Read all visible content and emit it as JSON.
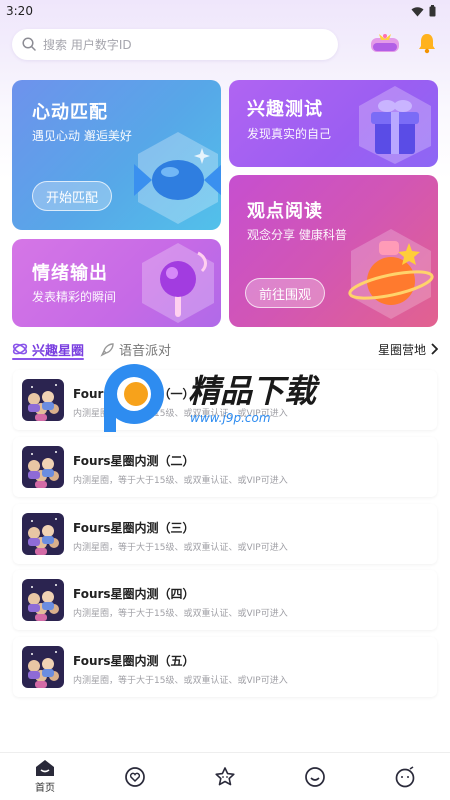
{
  "status_bar": {
    "time": "3:20"
  },
  "search": {
    "placeholder": "搜索 用户数字ID"
  },
  "header": {
    "badge_icon": "gift-badge-icon",
    "bell_icon": "bell-icon",
    "accent": "#8a55ea"
  },
  "cards": {
    "match": {
      "title": "心动匹配",
      "subtitle": "遇见心动 邂逅美好",
      "button": "开始匹配"
    },
    "interest": {
      "title": "兴趣测试",
      "subtitle": "发现真实的自己"
    },
    "emotion": {
      "title": "情绪输出",
      "subtitle": "发表精彩的瞬间"
    },
    "opinion": {
      "title": "观点阅读",
      "subtitle": "观念分享 健康科普",
      "button": "前往围观"
    }
  },
  "tabs": {
    "items": [
      {
        "label": "兴趣星圈",
        "active": true
      },
      {
        "label": "语音派对",
        "active": false
      }
    ],
    "link": "星圈营地"
  },
  "circles": [
    {
      "title": "Fours星圈内测（一）",
      "desc": "内测星圈，等于大于15级、或双重认证、或VIP可进入"
    },
    {
      "title": "Fours星圈内测（二）",
      "desc": "内测星圈，等于大于15级、或双重认证、或VIP可进入"
    },
    {
      "title": "Fours星圈内测（三）",
      "desc": "内测星圈，等于大于15级、或双重认证、或VIP可进入"
    },
    {
      "title": "Fours星圈内测（四）",
      "desc": "内测星圈，等于大于15级、或双重认证、或VIP可进入"
    },
    {
      "title": "Fours星圈内测（五）",
      "desc": "内测星圈，等于大于15级、或双重认证、或VIP可进入"
    }
  ],
  "watermark": {
    "title": "精品下载",
    "url": "www.j9p.com"
  },
  "bottom_nav": [
    {
      "label": "首页",
      "icon": "home-icon"
    },
    {
      "label": "",
      "icon": "heart-chat-icon"
    },
    {
      "label": "",
      "icon": "star-face-icon"
    },
    {
      "label": "",
      "icon": "smile-icon"
    },
    {
      "label": "",
      "icon": "profile-face-icon"
    }
  ]
}
